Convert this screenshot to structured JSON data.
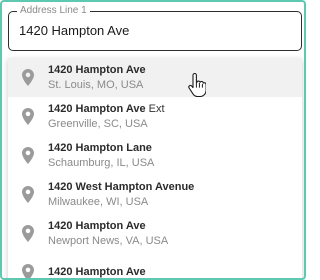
{
  "field": {
    "label": "Address Line 1",
    "value": "1420 Hampton Ave"
  },
  "suggestions": [
    {
      "main": "1420 Hampton Ave",
      "main_suffix": "",
      "secondary": "St. Louis, MO, USA"
    },
    {
      "main": "1420 Hampton Ave",
      "main_suffix": " Ext",
      "secondary": "Greenville, SC, USA"
    },
    {
      "main": "1420 Hampton Lane",
      "main_suffix": "",
      "secondary": "Schaumburg, IL, USA"
    },
    {
      "main": "1420 West Hampton Avenue",
      "main_suffix": "",
      "secondary": "Milwaukee, WI, USA"
    },
    {
      "main": "1420 Hampton Ave",
      "main_suffix": "",
      "secondary": "Newport News, VA, USA"
    },
    {
      "main": "1420 Hampton Ave",
      "main_suffix": "",
      "secondary": ""
    }
  ],
  "colors": {
    "frame_border": "#5ec9b0",
    "pin_icon": "#9b9b9b",
    "highlight": "#f1f1f1"
  }
}
